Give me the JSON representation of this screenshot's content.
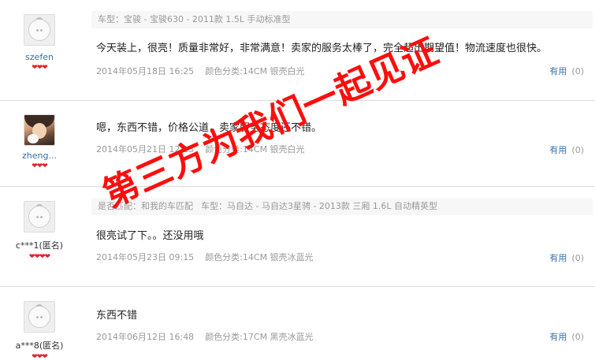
{
  "reviews": [
    {
      "username": "szefen",
      "avatar": "default-avatar-icon",
      "hearts": "❤❤❤",
      "meta_bar": "车型：宝骏 - 宝骏630 - 2011款 1.5L 手动标准型",
      "content": "今天装上，很亮！质量非常好，非常满意！卖家的服务太棒了，完全超出期望值！物流速度也很快。",
      "date": "2014年05月18日 16:25",
      "color_class": "颜色分类:14CM 银壳白光",
      "useful_label": "有用",
      "useful_count": "(0)"
    },
    {
      "username": "zheng...",
      "avatar": "user-photo-avatar",
      "hearts": "❤❤❤",
      "content": "嗯，东西不错，价格公道，卖家服务态度还不错。",
      "date": "2014年05月21日 12:13",
      "color_class": "颜色分类:14CM 银壳白光",
      "useful_label": "有用",
      "useful_count": "(0)"
    },
    {
      "username": "c***1(匿名)",
      "avatar": "default-avatar-icon",
      "hearts": "❤❤❤❤",
      "meta_bar_match": "是否匹配：和我的车匹配",
      "meta_bar": "车型：马自达 - 马自达3星骋 - 2013款 三厢 1.6L 自动精英型",
      "content": "很亮试了下。。还没用哦",
      "date": "2014年05月23日 09:15",
      "color_class": "颜色分类:14CM 银壳冰蓝光",
      "useful_label": "有用",
      "useful_count": "(0)"
    },
    {
      "username": "a***8(匿名)",
      "avatar": "default-avatar-icon",
      "hearts": "❤❤❤",
      "content": "东西不错",
      "date": "2014年06月12日 16:48",
      "color_class": "颜色分类:17CM 黑壳冰蓝光",
      "useful_label": "有用",
      "useful_count": "(0)"
    }
  ],
  "watermark": "第三方为我们一起见证",
  "colors": {
    "link": "#3a6ea5",
    "heart": "#e0232f",
    "watermark": "#ff0d0d",
    "meta_bg": "#f7f7f7"
  }
}
